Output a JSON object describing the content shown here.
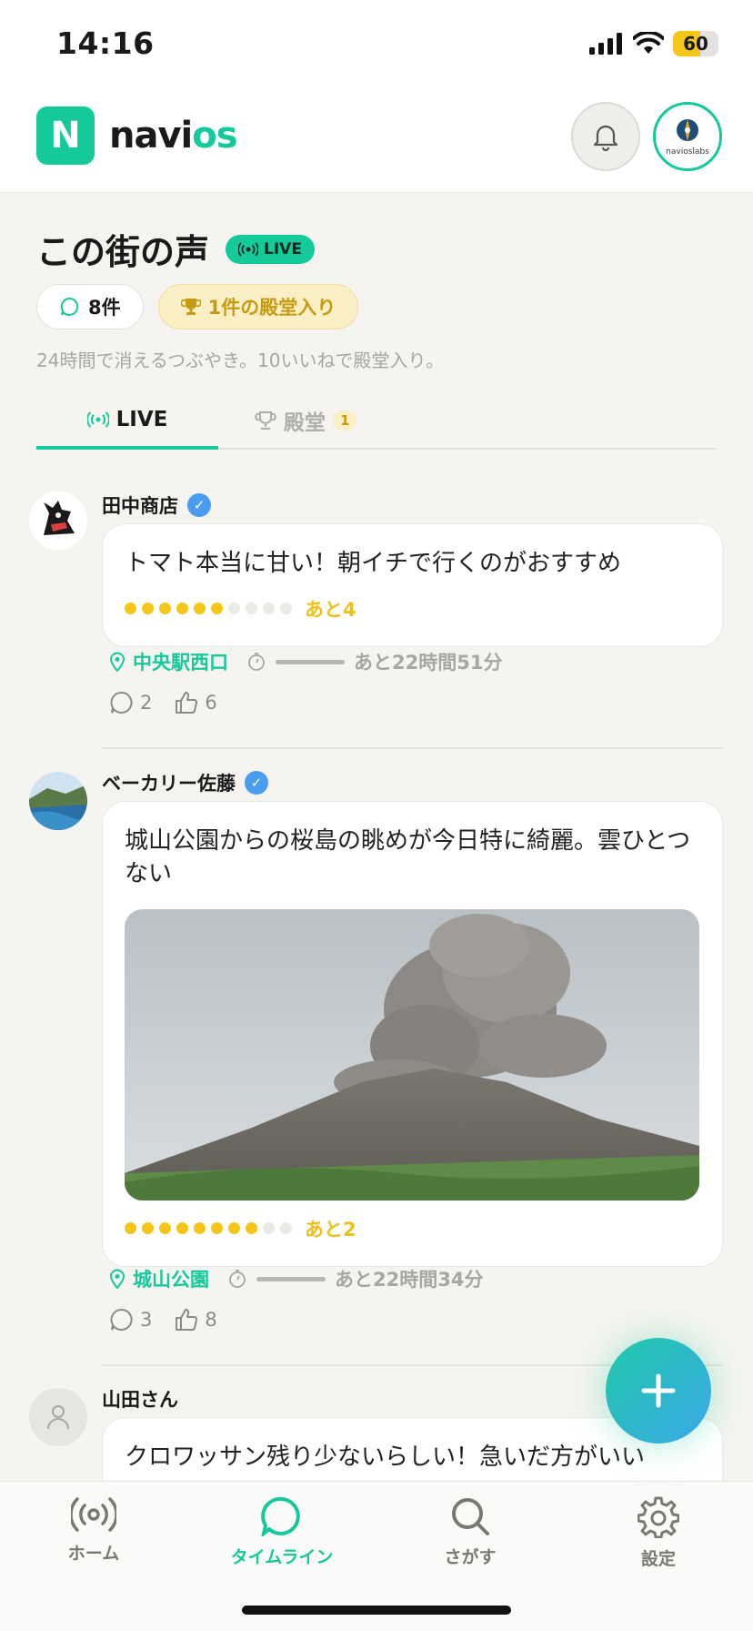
{
  "status_bar": {
    "time": "14:16",
    "battery": "60",
    "battery_level": 0.6
  },
  "header": {
    "logo_letter": "N",
    "brand_part1": "navi",
    "brand_part2": "os",
    "profile_label": "navioslabs"
  },
  "page": {
    "title": "この街の声",
    "live_badge": "LIVE",
    "count_chip": "8件",
    "hall_chip": "1件の殿堂入り",
    "subtitle": "24時間で消えるつぶやき。10いいねで殿堂入り。"
  },
  "tabs": [
    {
      "label": "LIVE",
      "active": true
    },
    {
      "label": "殿堂",
      "count": "1",
      "active": false
    }
  ],
  "posts": [
    {
      "author": "田中商店",
      "verified": true,
      "text": "トマト本当に甘い！朝イチで行くのがおすすめ",
      "likes_filled": 6,
      "likes_total": 10,
      "remaining": "あと4",
      "location": "中央駅西口",
      "time_left": "あと22時間51分",
      "comments": "2",
      "likes": "6"
    },
    {
      "author": "ベーカリー佐藤",
      "verified": true,
      "text": "城山公園からの桜島の眺めが今日特に綺麗。雲ひとつない",
      "has_image": true,
      "likes_filled": 8,
      "likes_total": 10,
      "remaining": "あと2",
      "location": "城山公園",
      "time_left": "あと22時間34分",
      "comments": "3",
      "likes": "8"
    },
    {
      "author": "山田さん",
      "verified": false,
      "text": "クロワッサン残り少ないらしい！急いだ方がいい"
    }
  ],
  "bottom_nav": [
    {
      "label": "ホーム",
      "icon": "broadcast-icon"
    },
    {
      "label": "タイムライン",
      "icon": "chat-bubble-icon",
      "active": true
    },
    {
      "label": "さがす",
      "icon": "search-icon"
    },
    {
      "label": "設定",
      "icon": "gear-icon"
    }
  ],
  "colors": {
    "accent": "#14c99a",
    "gold": "#f5c518",
    "background": "#f5f4f0"
  }
}
